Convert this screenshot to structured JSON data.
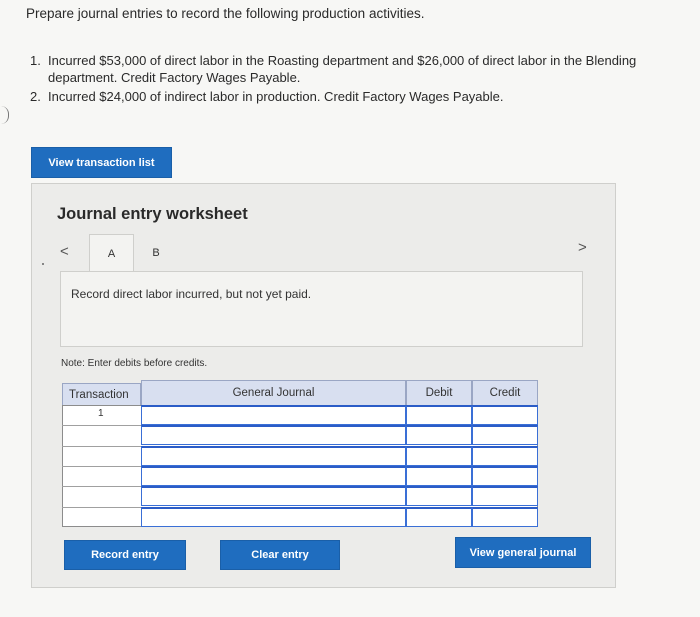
{
  "intro": "Prepare journal entries to record the following production activities.",
  "items": [
    {
      "num": "1.",
      "line1": "Incurred $53,000 of direct labor in the Roasting department and $26,000 of direct labor in the Blending",
      "line2": "department. Credit Factory Wages Payable."
    },
    {
      "num": "2.",
      "line1": "Incurred $24,000 of indirect labor in production. Credit Factory Wages Payable."
    }
  ],
  "buttons": {
    "view_transaction_list": "View transaction list",
    "record_entry": "Record entry",
    "clear_entry": "Clear entry",
    "view_general_journal": "View general journal"
  },
  "worksheet": {
    "title": "Journal entry worksheet",
    "tabs": [
      "A",
      "B"
    ],
    "nav_prev": "<",
    "nav_next": ">",
    "description": "Record direct labor incurred, but not yet paid.",
    "note": "Note: Enter debits before credits."
  },
  "table": {
    "headers": [
      "Transaction",
      "General Journal",
      "Debit",
      "Credit"
    ],
    "rows": [
      {
        "transaction": "1"
      },
      {
        "transaction": ""
      },
      {
        "transaction": ""
      },
      {
        "transaction": ""
      },
      {
        "transaction": ""
      },
      {
        "transaction": ""
      }
    ]
  },
  "colors": {
    "button": "#1f6dbf",
    "header": "#d8dff0",
    "input_border": "#3a6fd6"
  }
}
